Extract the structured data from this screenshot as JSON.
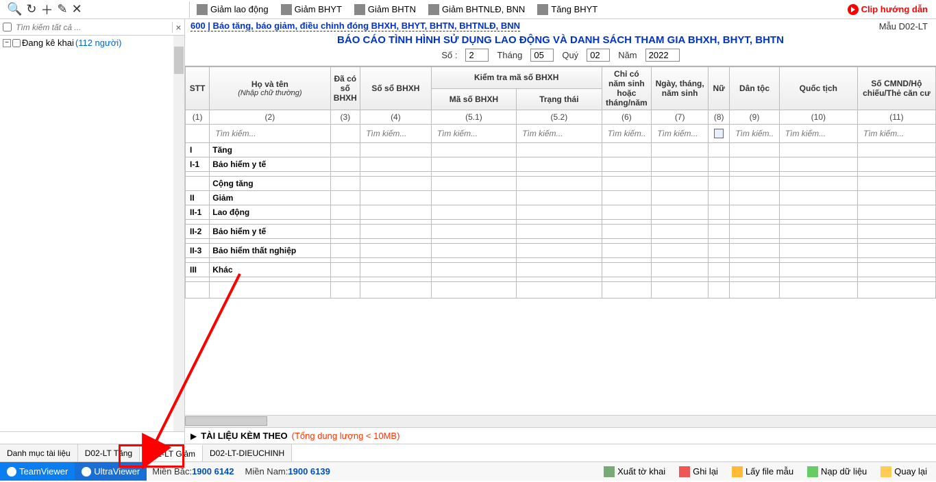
{
  "left_toolbar": {
    "search_placeholder": "Tìm kiếm tất cả ..."
  },
  "tree": {
    "label": "Đang kê khai",
    "count": "(112 người)"
  },
  "top_actions": {
    "giam_ld": "Giảm lao động",
    "giam_bhyt": "Giảm BHYT",
    "giam_bhtn": "Giảm BHTN",
    "giam_bhtnld": "Giảm BHTNLĐ, BNN",
    "tang_bhyt": "Tăng BHYT",
    "clip": "Clip hướng dẫn"
  },
  "header": {
    "code": "600 | Báo tăng, báo giảm, điều chỉnh đóng BHXH, BHYT, BHTN, BHTNLĐ, BNN",
    "mau": "Mẫu D02-LT",
    "title": "BÁO CÁO TÌNH HÌNH SỬ DỤNG LAO ĐỘNG VÀ DANH SÁCH THAM GIA BHXH, BHYT, BHTN",
    "so_lbl": "Số :",
    "so_val": "2",
    "thang_lbl": "Tháng",
    "thang_val": "05",
    "quy_lbl": "Quý",
    "quy_val": "02",
    "nam_lbl": "Năm",
    "nam_val": "2022"
  },
  "cols": {
    "stt": "STT",
    "hoten": "Họ và tên",
    "hoten_sub": "(Nhập chữ thường)",
    "daco": "Đã có số BHXH",
    "soso": "Số sổ BHXH",
    "ktms": "Kiểm tra mã số BHXH",
    "maso": "Mã số BHXH",
    "trangthai": "Trạng thái",
    "chico": "Chỉ có năm sinh hoặc tháng/năm",
    "ngaysinh": "Ngày, tháng, năm sinh",
    "nu": "Nữ",
    "dantoc": "Dân tộc",
    "quoctich": "Quốc tịch",
    "cmnd": "Số CMND/Hộ chiếu/Thẻ căn cư",
    "n1": "(1)",
    "n2": "(2)",
    "n3": "(3)",
    "n4": "(4)",
    "n51": "(5.1)",
    "n52": "(5.2)",
    "n6": "(6)",
    "n7": "(7)",
    "n8": "(8)",
    "n9": "(9)",
    "n10": "(10)",
    "n11": "(11)",
    "filter": "Tìm kiếm..."
  },
  "rows": {
    "r1_stt": "I",
    "r1_lbl": "Tăng",
    "r2_stt": "I-1",
    "r2_lbl": "Bảo hiểm y tế",
    "sum1": "Cộng tăng",
    "r3_stt": "II",
    "r3_lbl": "Giảm",
    "r4_stt": "II-1",
    "r4_lbl": "Lao động",
    "r5_stt": "II-2",
    "r5_lbl": "Bảo hiểm y tế",
    "r6_stt": "II-3",
    "r6_lbl": "Bảo hiểm thất nghiệp",
    "r7_stt": "III",
    "r7_lbl": "Khác"
  },
  "attach": {
    "label": "TÀI LIỆU KÈM THEO",
    "note": "(Tổng dung lượng < 10MB)"
  },
  "tabs": {
    "t1": "Danh mục tài liệu",
    "t2": "D02-LT Tăng",
    "t3": "D02-LT Giảm",
    "t4": "D02-LT-DIEUCHINH"
  },
  "status": {
    "tv": "TeamViewer",
    "uv": "UltraViewer",
    "mb_lbl": "Miền Bắc:",
    "mb_val": "1900 6142",
    "mn_lbl": "Miền Nam:",
    "mn_val": "1900 6139",
    "xuat": "Xuất tờ khai",
    "ghi": "Ghi lại",
    "lay": "Lấy file mẫu",
    "nap": "Nạp dữ liệu",
    "quay": "Quay lại"
  }
}
